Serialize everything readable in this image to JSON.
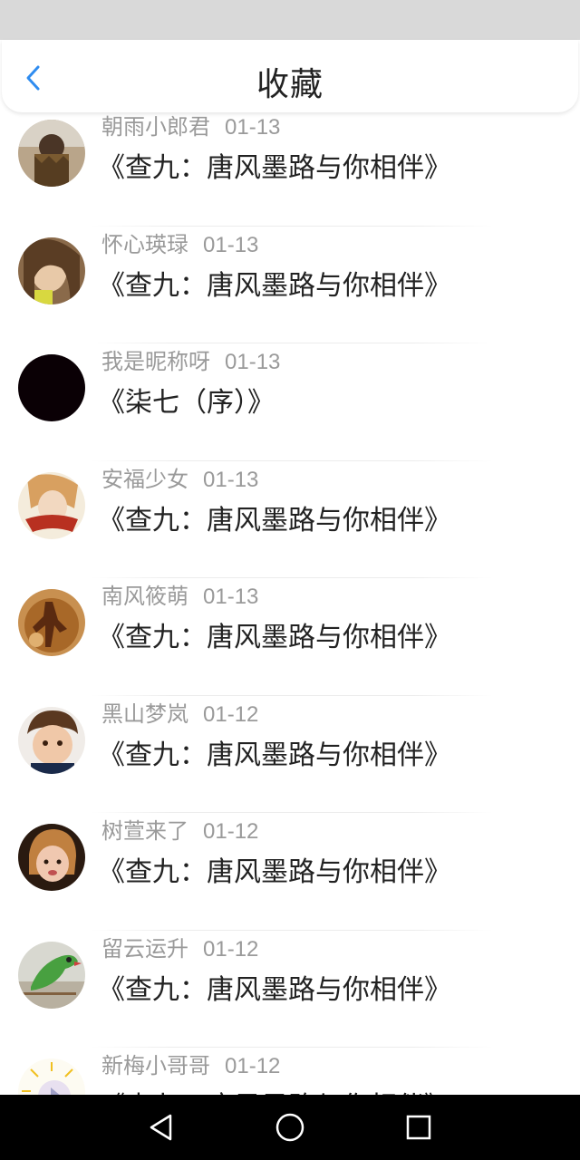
{
  "header": {
    "title": "收藏"
  },
  "colors": {
    "accent": "#2f8cf0",
    "status_bar": "#d9d9d9",
    "nav_bar": "#000000"
  },
  "items": [
    {
      "name": "朝雨小郎君",
      "date": "01-13",
      "title": "《查九：唐风墨路与你相伴》"
    },
    {
      "name": "怀心瑛琭",
      "date": "01-13",
      "title": "《查九：唐风墨路与你相伴》"
    },
    {
      "name": "我是昵称呀",
      "date": "01-13",
      "title": "《柒七（序）》"
    },
    {
      "name": "安福少女",
      "date": "01-13",
      "title": "《查九：唐风墨路与你相伴》"
    },
    {
      "name": "南风筱萌",
      "date": "01-13",
      "title": "《查九：唐风墨路与你相伴》"
    },
    {
      "name": "黑山梦岚",
      "date": "01-12",
      "title": "《查九：唐风墨路与你相伴》"
    },
    {
      "name": "树萱来了",
      "date": "01-12",
      "title": "《查九：唐风墨路与你相伴》"
    },
    {
      "name": "留云运升",
      "date": "01-12",
      "title": "《查九：唐风墨路与你相伴》"
    },
    {
      "name": "新梅小哥哥",
      "date": "01-12",
      "title": "《查九：唐风墨路与你相伴》"
    }
  ],
  "nav": {
    "back_icon": "triangle-back-icon",
    "home_icon": "circle-home-icon",
    "recents_icon": "square-recents-icon"
  }
}
